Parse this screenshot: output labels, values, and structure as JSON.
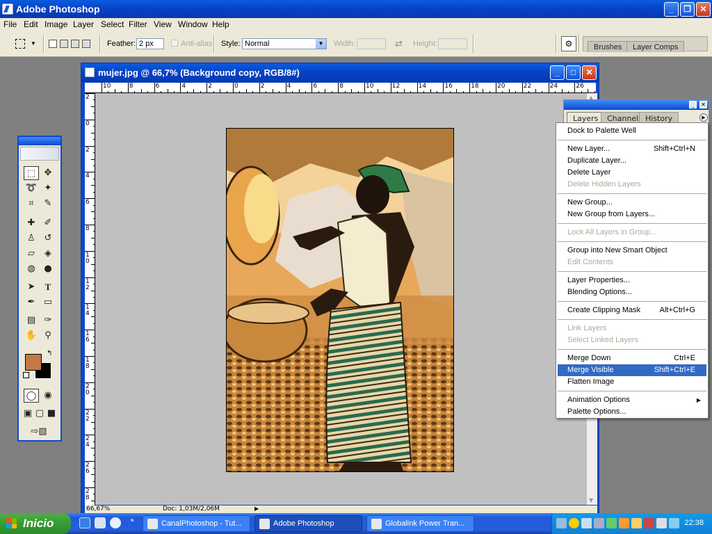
{
  "app": {
    "title": "Adobe Photoshop",
    "menu": [
      "File",
      "Edit",
      "Image",
      "Layer",
      "Select",
      "Filter",
      "View",
      "Window",
      "Help"
    ]
  },
  "options_bar": {
    "feather_label": "Feather:",
    "feather_value": "2 px",
    "antialias_label": "Anti-alias",
    "style_label": "Style:",
    "style_value": "Normal",
    "width_label": "Width:",
    "height_label": "Height:",
    "palette_well_tabs": [
      "Brushes",
      "Layer Comps"
    ]
  },
  "document": {
    "title": "mujer.jpg @ 66,7% (Background copy, RGB/8#)",
    "ruler_h": [
      "10",
      "8",
      "6",
      "4",
      "2",
      "0",
      "2",
      "4",
      "6",
      "8",
      "10",
      "12",
      "14",
      "16",
      "18",
      "20",
      "22",
      "24",
      "26"
    ],
    "ruler_v": [
      "2",
      "0",
      "2",
      "4",
      "6",
      "8",
      "10",
      "12",
      "14",
      "16",
      "18",
      "20",
      "22",
      "24",
      "26",
      "28"
    ],
    "zoom": "66,67%",
    "doc_info": "Doc: 1,03M/2,06M"
  },
  "colors": {
    "foreground": "#c27a45",
    "background": "#000000",
    "highlight": "#316ac5"
  },
  "layers_panel": {
    "tabs": [
      "Layers",
      "Channels",
      "History"
    ]
  },
  "flyout_menu": {
    "groups": [
      [
        {
          "label": "Dock to Palette Well",
          "shortcut": "",
          "enabled": true
        }
      ],
      [
        {
          "label": "New Layer...",
          "shortcut": "Shift+Ctrl+N",
          "enabled": true
        },
        {
          "label": "Duplicate Layer...",
          "shortcut": "",
          "enabled": true
        },
        {
          "label": "Delete Layer",
          "shortcut": "",
          "enabled": true
        },
        {
          "label": "Delete Hidden Layers",
          "shortcut": "",
          "enabled": false
        }
      ],
      [
        {
          "label": "New Group...",
          "shortcut": "",
          "enabled": true
        },
        {
          "label": "New Group from Layers...",
          "shortcut": "",
          "enabled": true
        }
      ],
      [
        {
          "label": "Lock All Layers in Group...",
          "shortcut": "",
          "enabled": false
        }
      ],
      [
        {
          "label": "Group into New Smart Object",
          "shortcut": "",
          "enabled": true
        },
        {
          "label": "Edit Contents",
          "shortcut": "",
          "enabled": false
        }
      ],
      [
        {
          "label": "Layer Properties...",
          "shortcut": "",
          "enabled": true
        },
        {
          "label": "Blending Options...",
          "shortcut": "",
          "enabled": true
        }
      ],
      [
        {
          "label": "Create Clipping Mask",
          "shortcut": "Alt+Ctrl+G",
          "enabled": true
        }
      ],
      [
        {
          "label": "Link Layers",
          "shortcut": "",
          "enabled": false
        },
        {
          "label": "Select Linked Layers",
          "shortcut": "",
          "enabled": false
        }
      ],
      [
        {
          "label": "Merge Down",
          "shortcut": "Ctrl+E",
          "enabled": true
        },
        {
          "label": "Merge Visible",
          "shortcut": "Shift+Ctrl+E",
          "enabled": true,
          "highlighted": true
        },
        {
          "label": "Flatten Image",
          "shortcut": "",
          "enabled": true
        }
      ],
      [
        {
          "label": "Animation Options",
          "shortcut": "",
          "enabled": true,
          "submenu": true
        },
        {
          "label": "Palette Options...",
          "shortcut": "",
          "enabled": true
        }
      ]
    ]
  },
  "taskbar": {
    "start_label": "Inicio",
    "tasks": [
      {
        "label": "CanalPhotoshop - Tut...",
        "active": false
      },
      {
        "label": "Adobe Photoshop",
        "active": true
      },
      {
        "label": "Globalink Power Tran...",
        "active": false
      }
    ],
    "clock": "22:38"
  }
}
